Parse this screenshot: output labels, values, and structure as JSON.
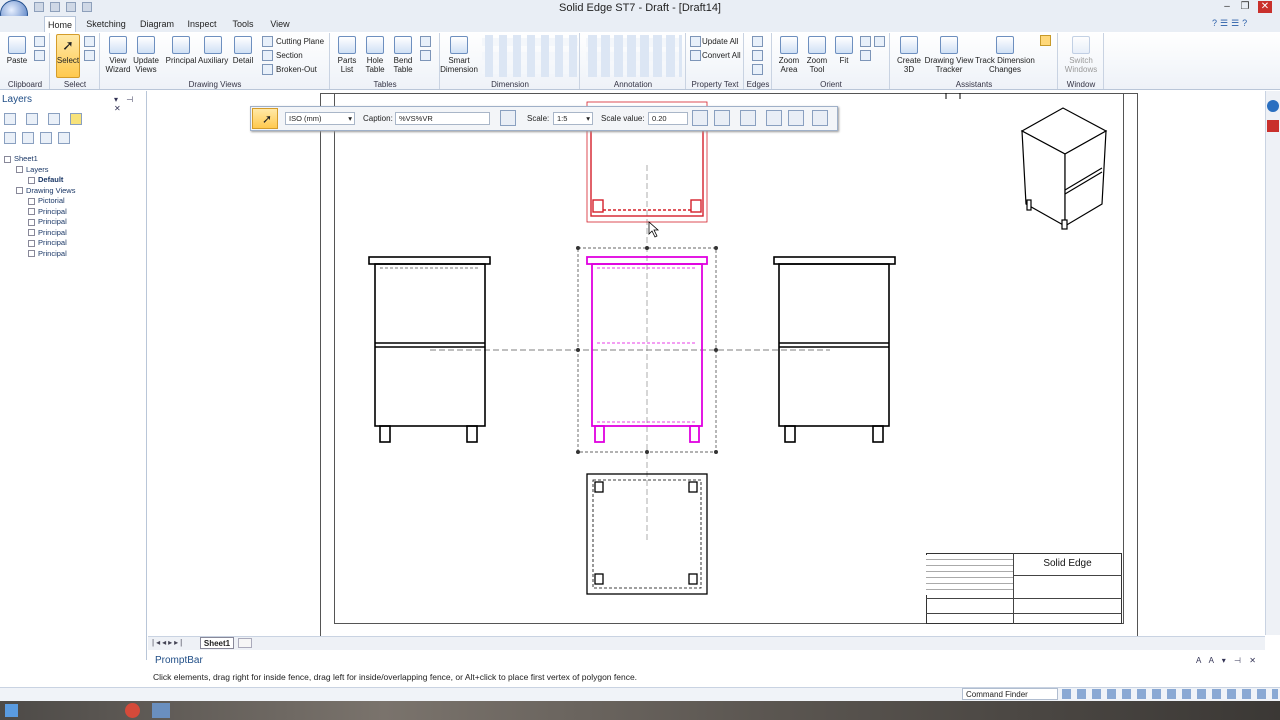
{
  "window": {
    "title": "Solid Edge ST7 - Draft - [Draft14]"
  },
  "tabs": [
    {
      "label": "Home",
      "active": true
    },
    {
      "label": "Sketching"
    },
    {
      "label": "Diagram"
    },
    {
      "label": "Inspect"
    },
    {
      "label": "Tools"
    },
    {
      "label": "View"
    }
  ],
  "ribbon": {
    "groups": {
      "clipboard": "Clipboard",
      "select": "Select",
      "drawing_views": "Drawing Views",
      "tables": "Tables",
      "dimension": "Dimension",
      "annotation": "Annotation",
      "property_text": "Property Text",
      "edges": "Edges",
      "orient": "Orient",
      "assistants": "Assistants",
      "window": "Window"
    },
    "buttons": {
      "paste": "Paste",
      "select": "Select",
      "view_wizard_1": "View",
      "view_wizard_2": "Wizard",
      "update_views_1": "Update",
      "update_views_2": "Views",
      "principal": "Principal",
      "auxiliary": "Auxiliary",
      "detail": "Detail",
      "cutting_plane": "Cutting Plane",
      "section": "Section",
      "broken_out": "Broken-Out",
      "parts_list_1": "Parts",
      "parts_list_2": "List",
      "hole_table_1": "Hole",
      "hole_table_2": "Table",
      "bend_table_1": "Bend",
      "bend_table_2": "Table",
      "smart_dimension_1": "Smart",
      "smart_dimension_2": "Dimension",
      "update_all": "Update All",
      "convert_all": "Convert All",
      "zoom_area_1": "Zoom",
      "zoom_area_2": "Area",
      "zoom_tool_1": "Zoom",
      "zoom_tool_2": "Tool",
      "fit": "Fit",
      "create_3d_1": "Create",
      "create_3d_2": "3D",
      "dv_tracker_1": "Drawing View",
      "dv_tracker_2": "Tracker",
      "track_dim_1": "Track Dimension",
      "track_dim_2": "Changes",
      "switch_windows_1": "Switch",
      "switch_windows_2": "Windows"
    }
  },
  "panel": {
    "title": "Layers",
    "tree": [
      {
        "label": "Sheet1",
        "indent": 0,
        "bold": false
      },
      {
        "label": "Layers",
        "indent": 1,
        "bold": false
      },
      {
        "label": "Default",
        "indent": 2,
        "bold": true
      },
      {
        "label": "Drawing Views",
        "indent": 1,
        "bold": false
      },
      {
        "label": "Pictorial",
        "indent": 2,
        "bold": false
      },
      {
        "label": "Principal",
        "indent": 2,
        "bold": false
      },
      {
        "label": "Principal",
        "indent": 2,
        "bold": false
      },
      {
        "label": "Principal",
        "indent": 2,
        "bold": false
      },
      {
        "label": "Principal",
        "indent": 2,
        "bold": false
      },
      {
        "label": "Principal",
        "indent": 2,
        "bold": false
      }
    ]
  },
  "command_bar": {
    "standard": "ISO (mm)",
    "caption_label": "Caption:",
    "caption_value": "%VS%VR",
    "scale_label": "Scale:",
    "scale_value": "1:5",
    "scale_value_label": "Scale value:",
    "scale_value_value": "0.20"
  },
  "title_block": {
    "brand": "Solid Edge"
  },
  "sheet_tabs": {
    "active": "Sheet1"
  },
  "prompt": {
    "title": "PromptBar",
    "message": "Click elements, drag right for inside fence, drag left for inside/overlapping fence, or Alt+click to place first vertex of polygon fence."
  },
  "status": {
    "command_finder": "Command Finder"
  },
  "colors": {
    "selected": "#e000e0",
    "highlight": "#d4202a"
  }
}
